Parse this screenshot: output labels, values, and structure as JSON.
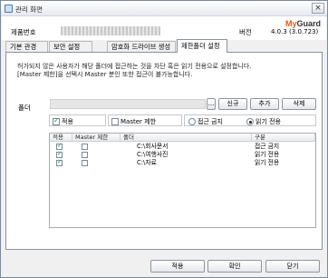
{
  "window": {
    "title": "관리 화면",
    "close_icon": "close-icon"
  },
  "header": {
    "product_label": "제품번호",
    "version_label": "버전",
    "version_value": "4.0.3  (3.0.723)",
    "logo": {
      "my": "My",
      "rest": "Guard"
    }
  },
  "tabs": [
    {
      "label": "기본 관경",
      "active": false
    },
    {
      "label": "보안 설정",
      "active": false
    },
    {
      "label": "암호화 드라이브 생성",
      "active": false
    },
    {
      "label": "제한폴더 설정",
      "active": true
    }
  ],
  "description": {
    "line1": "허가되지 않은 사용자가 해당 폴더에 접근하는 것을 차단 혹은 읽기 전용으로 설정합니다.",
    "line2": "[Master 제한]을 선택시 Master 분인 또한 접근이 불가능합니다."
  },
  "folder": {
    "label": "폴더",
    "value": "",
    "browse_label": "...",
    "new_label": "신규",
    "add_label": "추가",
    "delete_label": "삭제"
  },
  "options": {
    "apply_label": "적용",
    "apply_checked": true,
    "master_label": "Master 제한",
    "master_checked": false,
    "block_label": "접근 금지",
    "readonly_label": "읽기 전용",
    "selected_mode": "readonly"
  },
  "table": {
    "columns": [
      "적용",
      "Master 제한",
      "폴더",
      "구분"
    ],
    "rows": [
      {
        "apply": true,
        "master": false,
        "folder": "C:\\회사문서",
        "type": "접근 금지"
      },
      {
        "apply": true,
        "master": false,
        "folder": "C:\\여행사진",
        "type": "읽기 전용"
      },
      {
        "apply": true,
        "master": false,
        "folder": "C:\\자료",
        "type": "읽기 전용"
      }
    ]
  },
  "footer": {
    "apply_label": "적용",
    "ok_label": "확인",
    "close_label": "닫기"
  }
}
